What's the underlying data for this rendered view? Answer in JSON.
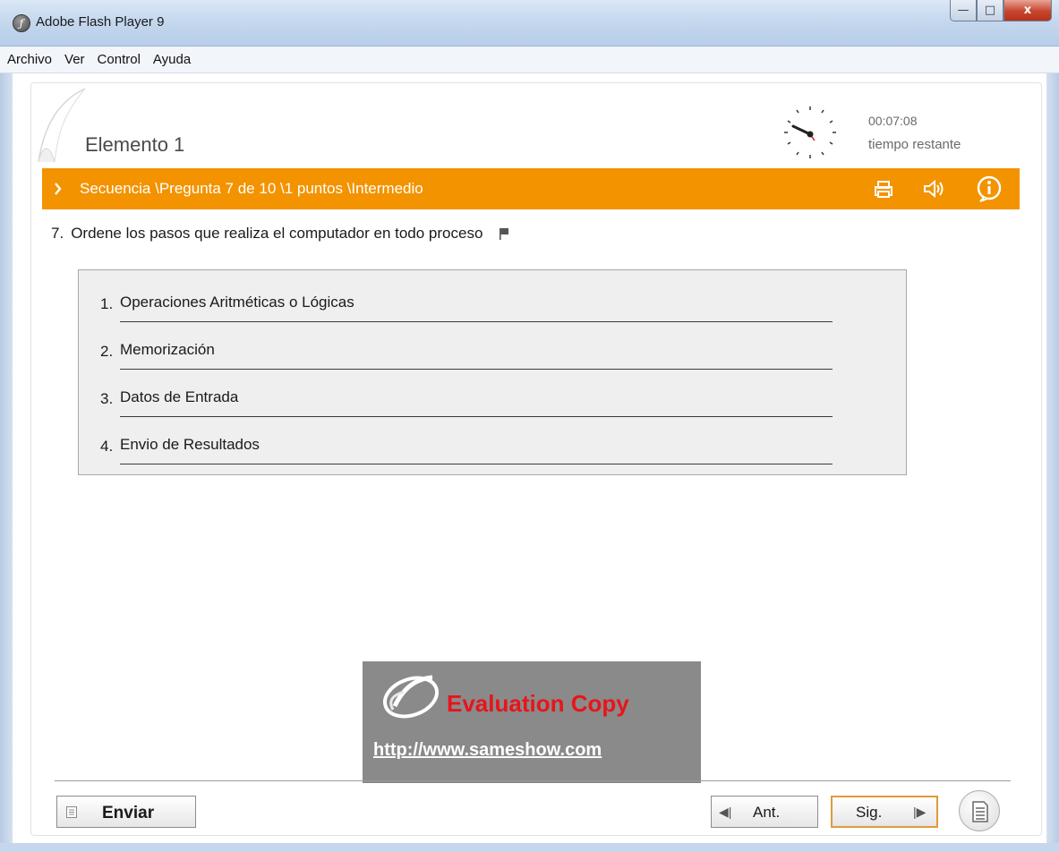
{
  "window": {
    "title": "Adobe Flash Player 9",
    "controls": {
      "minimize": "—",
      "maximize": "□",
      "close": "x"
    }
  },
  "menu": [
    "Archivo",
    "Ver",
    "Control",
    "Ayuda"
  ],
  "quiz": {
    "element_title": "Elemento 1",
    "timer": {
      "value": "00:07:08",
      "label": "tiempo restante"
    },
    "header_bar": {
      "text": "Secuencia \\Pregunta 7 de  10 \\1 puntos \\Intermedio",
      "color": "#f39300",
      "icons": [
        "print-icon",
        "sound-icon",
        "info-icon"
      ]
    },
    "question": {
      "number": "7.",
      "text": "Ordene los pasos que realiza el computador en todo proceso"
    },
    "items": [
      {
        "number": "1.",
        "text": "Operaciones Aritméticas o Lógicas"
      },
      {
        "number": "2.",
        "text": "Memorización"
      },
      {
        "number": "3.",
        "text": "Datos de Entrada"
      },
      {
        "number": "4.",
        "text": "Envio de Resultados"
      }
    ]
  },
  "watermark": {
    "title": "Evaluation Copy",
    "url": "http://www.sameshow.com"
  },
  "footer": {
    "submit_label": "Enviar",
    "prev_label": "Ant.",
    "next_label": "Sig."
  }
}
